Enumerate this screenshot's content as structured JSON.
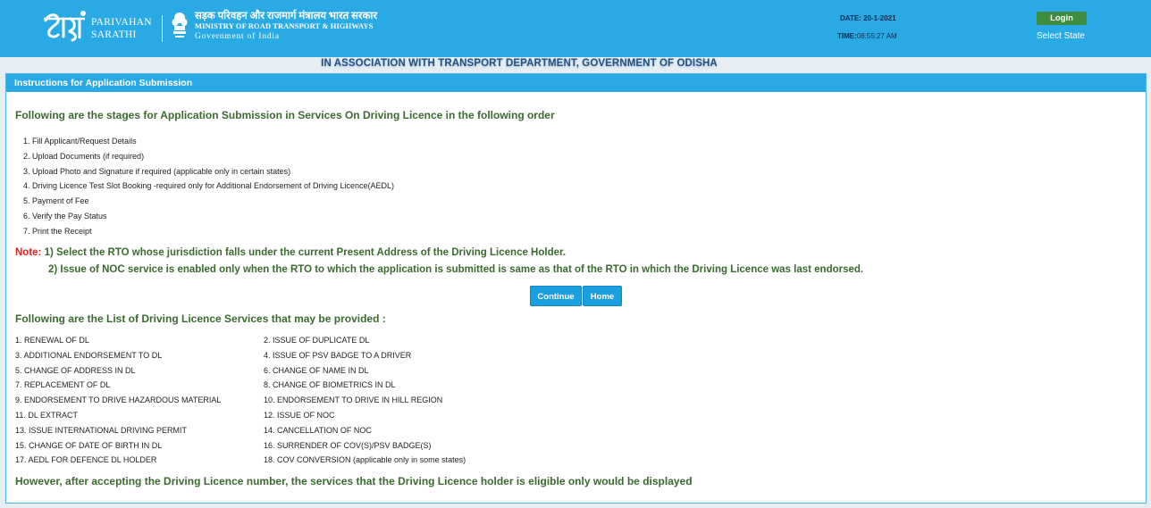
{
  "header": {
    "logo_brand": "PARIVAHAN",
    "logo_product": "SARATHI",
    "ministry_hindi": "सड़क परिवहन और राजमार्ग मंत्रालय भारत सरकार",
    "ministry_english": "MINISTRY OF ROAD TRANSPORT & HIGHWAYS",
    "government": "Government of India",
    "date_label": "DATE:",
    "date_value": "20-1-2021",
    "time_label": "TIME:",
    "time_value": "08:55:27 AM",
    "login_label": "Login",
    "select_state_label": "Select State",
    "brand_color": "#2aaae5"
  },
  "association": "IN ASSOCIATION WITH TRANSPORT DEPARTMENT, GOVERNMENT OF ODISHA",
  "panel": {
    "title": "Instructions for Application Submission",
    "stages_intro": "Following are the stages for Application Submission in Services On Driving Licence in the following order",
    "stages": [
      "1. Fill Applicant/Request Details",
      "2. Upload Documents (if required)",
      "3. Upload Photo and Signature if required (applicable only in certain states)",
      "4. Driving Licence Test Slot Booking -required only for Additional Endorsement of Driving Licence(AEDL)",
      "5. Payment of Fee",
      "6. Verify the Pay Status",
      "7. Print the Receipt"
    ],
    "note_label": "Note:",
    "note_1": "1) Select the RTO whose jurisdiction falls under the current Present Address of the Driving Licence Holder.",
    "note_2": "2) Issue of NOC service is enabled only when the RTO to which the application is submitted is same as that of the RTO in which the Driving Licence was last endorsed.",
    "continue_label": "Continue",
    "home_label": "Home",
    "services_intro": "Following are the List of Driving Licence Services that may be provided :",
    "services_left": [
      "1.  RENEWAL OF DL",
      "3.  ADDITIONAL ENDORSEMENT TO DL",
      "5.  CHANGE OF ADDRESS IN DL",
      "7.  REPLACEMENT OF DL",
      "9.  ENDORSEMENT TO DRIVE HAZARDOUS MATERIAL",
      "11. DL EXTRACT",
      "13. ISSUE INTERNATIONAL DRIVING PERMIT",
      "15. CHANGE OF DATE OF BIRTH IN DL",
      "17. AEDL FOR DEFENCE DL HOLDER"
    ],
    "services_right": [
      "2.  ISSUE OF DUPLICATE DL",
      "4.  ISSUE OF PSV BADGE TO A DRIVER",
      "6.  CHANGE OF NAME IN DL",
      "8.  CHANGE OF BIOMETRICS IN DL",
      "10. ENDORSEMENT TO DRIVE IN HILL REGION",
      "12. ISSUE OF NOC",
      "14. CANCELLATION OF NOC",
      "16.  SURRENDER OF COV(S)/PSV BADGE(S)",
      "18. COV CONVERSION (applicable only in some states)"
    ],
    "footer_note": "However, after accepting the Driving Licence number, the services that the Driving Licence holder is eligible only would be displayed"
  }
}
